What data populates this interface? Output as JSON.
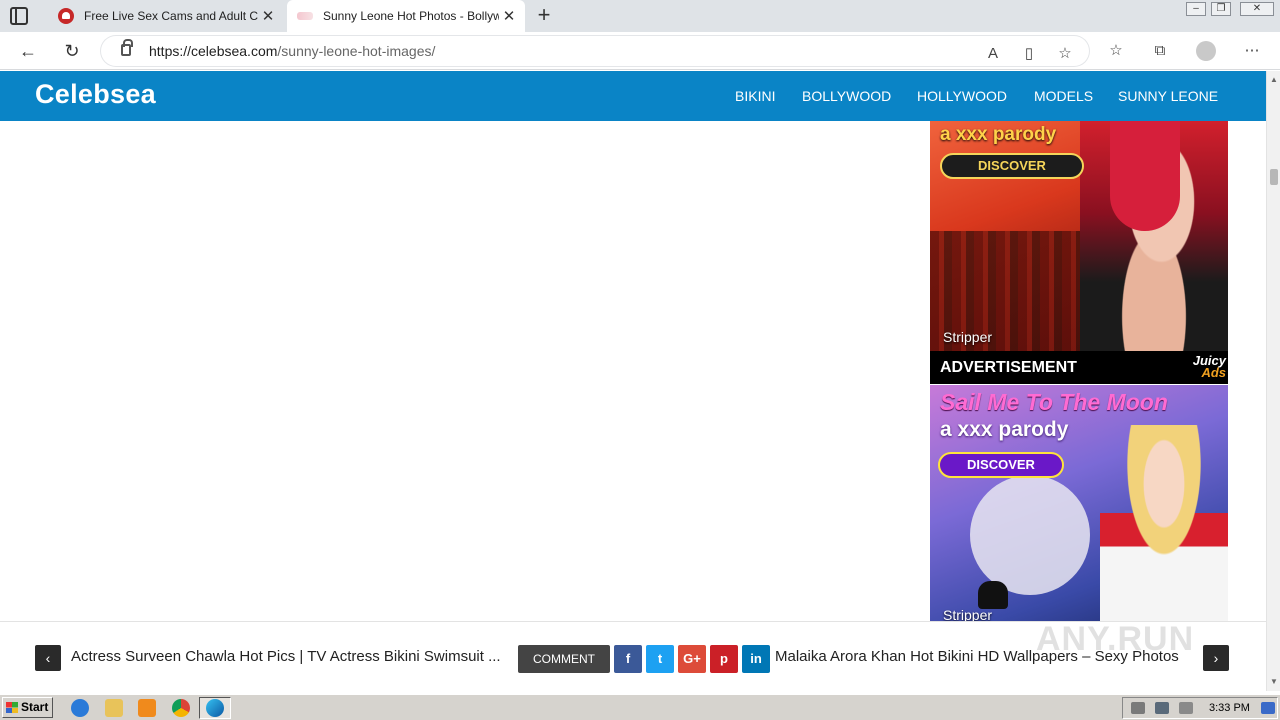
{
  "browser": {
    "tabs": [
      {
        "title": "Free Live Sex Cams and Adult Ch",
        "close": "✕"
      },
      {
        "title": "Sunny Leone Hot Photos - Bollyw",
        "close": "✕"
      }
    ],
    "new_tab": "+",
    "url_host": "https://celebsea.com",
    "url_path": "/sunny-leone-hot-images/",
    "nav": {
      "back": "←",
      "refresh": "↻"
    },
    "window_controls": {
      "minimize": "–",
      "restore": "❐",
      "close": "✕"
    }
  },
  "site": {
    "logo": "Celebsea",
    "nav": [
      "BIKINI",
      "BOLLYWOOD",
      "HOLLYWOOD",
      "MODELS",
      "SUNNY LEONE"
    ]
  },
  "ads": {
    "ad1": {
      "headline": "a xxx parody",
      "button": "DISCOVER",
      "caption": "Stripper"
    },
    "strip": {
      "label": "ADVERTISEMENT",
      "brand_top": "Juicy",
      "brand_bottom": "Ads"
    },
    "ad2": {
      "headline1": "Sail Me To The Moon",
      "headline2": "a xxx parody",
      "button": "DISCOVER",
      "caption": "Stripper"
    }
  },
  "post_nav": {
    "prev_title": "Actress Surveen Chawla Hot Pics | TV Actress Bikini Swimsuit ...",
    "comment": "COMMENT",
    "share": [
      {
        "icon": "facebook-icon",
        "glyph": "f",
        "color": "#3b5998"
      },
      {
        "icon": "twitter-icon",
        "glyph": "t",
        "color": "#1da1f2"
      },
      {
        "icon": "google-plus-icon",
        "glyph": "G+",
        "color": "#dd4b39"
      },
      {
        "icon": "pinterest-icon",
        "glyph": "p",
        "color": "#cb2027"
      },
      {
        "icon": "linkedin-icon",
        "glyph": "in",
        "color": "#0077b5"
      }
    ],
    "next_title": "Malaika Arora Khan Hot Bikini HD Wallpapers – Sexy Photos",
    "prev_arrow": "‹",
    "next_arrow": "›"
  },
  "watermark": "ANY.RUN",
  "taskbar": {
    "start": "Start",
    "time": "3:33 PM"
  },
  "colors": {
    "header": "#0a84c6",
    "tabbar": "#dfe3e7"
  }
}
